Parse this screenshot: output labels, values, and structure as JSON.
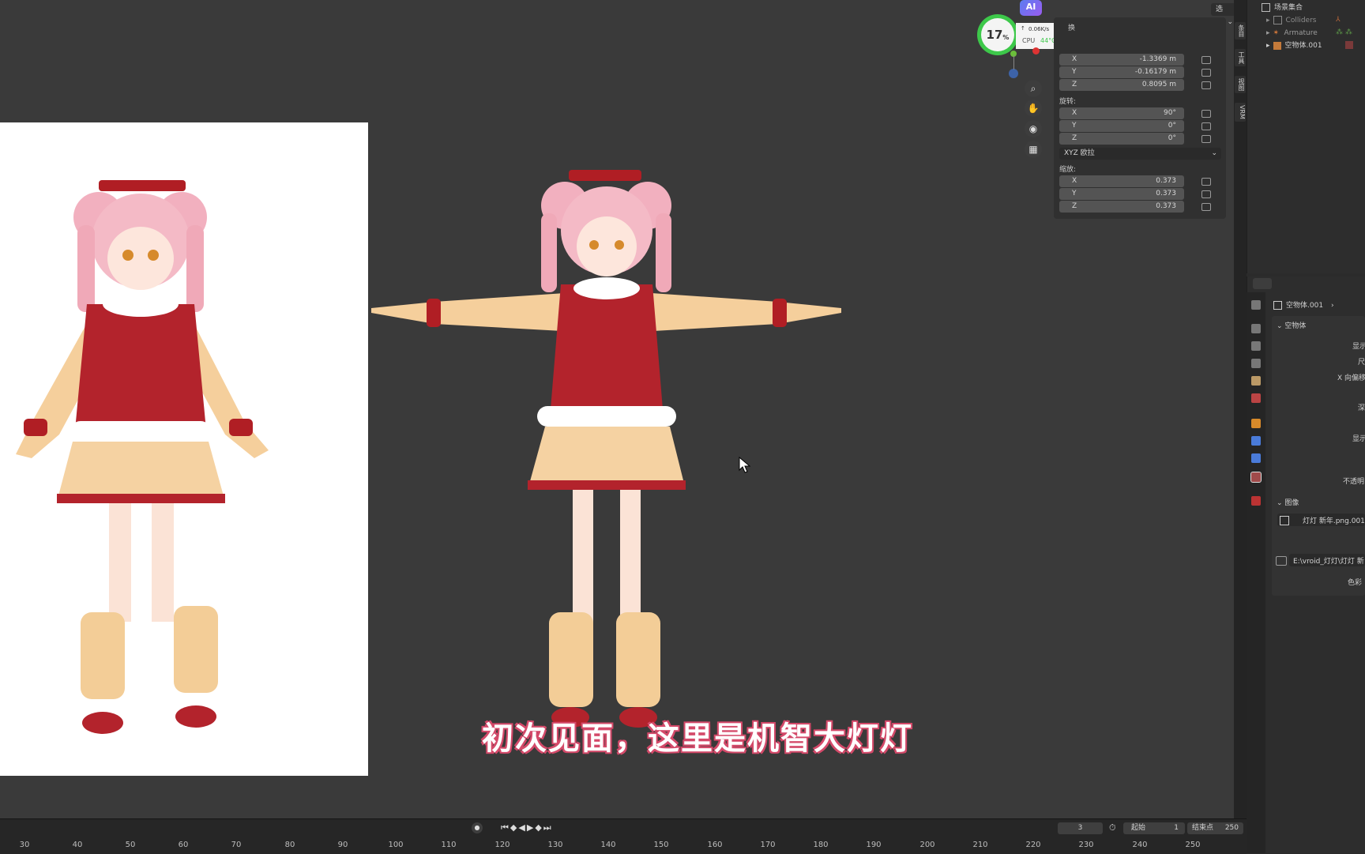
{
  "header": {
    "options_label": "选项"
  },
  "overlay": {
    "ai_badge": "AI",
    "cpu_usage": "17",
    "cpu_percent": "%",
    "net_speed": "0.06K/s",
    "cpu_label": "CPU",
    "cpu_temp": "44°C"
  },
  "npanel": {
    "transform_title_partial": "换",
    "location": [
      {
        "axis": "X",
        "value": "-1.3369 m"
      },
      {
        "axis": "Y",
        "value": "-0.16179 m"
      },
      {
        "axis": "Z",
        "value": "0.8095 m"
      }
    ],
    "rotation_label": "旋转:",
    "rotation": [
      {
        "axis": "X",
        "value": "90°"
      },
      {
        "axis": "Y",
        "value": "0°"
      },
      {
        "axis": "Z",
        "value": "0°"
      }
    ],
    "rotation_mode": "XYZ 欧拉",
    "scale_label": "缩放:",
    "scale": [
      {
        "axis": "X",
        "value": "0.373"
      },
      {
        "axis": "Y",
        "value": "0.373"
      },
      {
        "axis": "Z",
        "value": "0.373"
      }
    ],
    "side_tabs": [
      "条目",
      "工具",
      "视图",
      "VRM"
    ]
  },
  "outliner": {
    "items": [
      {
        "label": "场景集合",
        "icon": "collection-icon"
      },
      {
        "label": "Colliders",
        "icon": "collection-icon"
      },
      {
        "label": "Armature",
        "icon": "armature-icon"
      },
      {
        "label": "空物体.001",
        "icon": "empty-image-icon"
      }
    ]
  },
  "properties": {
    "breadcrumb_object": "空物体.001",
    "section_empty": "空物体",
    "labels": [
      "显示",
      "尺",
      "X 向偏移",
      "深",
      "显示",
      "不透明"
    ],
    "section_image": "图像",
    "image_name": "灯灯 新年.png.001",
    "image_path": "E:\\vroid_灯灯\\灯灯 新",
    "color_label": "色彩"
  },
  "timeline": {
    "current_frame": "3",
    "start_label": "起始",
    "start_value": "1",
    "end_label": "结束点",
    "end_value": "250",
    "ruler": [
      "30",
      "40",
      "50",
      "60",
      "70",
      "80",
      "90",
      "100",
      "110",
      "120",
      "130",
      "140",
      "150",
      "160",
      "170",
      "180",
      "190",
      "200",
      "210",
      "220",
      "230",
      "240",
      "250"
    ]
  },
  "subtitle": "初次见面，这里是机智大灯灯",
  "colors": {
    "viewport_bg": "#3a3a3a",
    "panel_bg": "#2d2d2d",
    "field_bg": "#545454",
    "accent_blue": "#4a7bd9",
    "cpu_green": "#3dc84a"
  }
}
